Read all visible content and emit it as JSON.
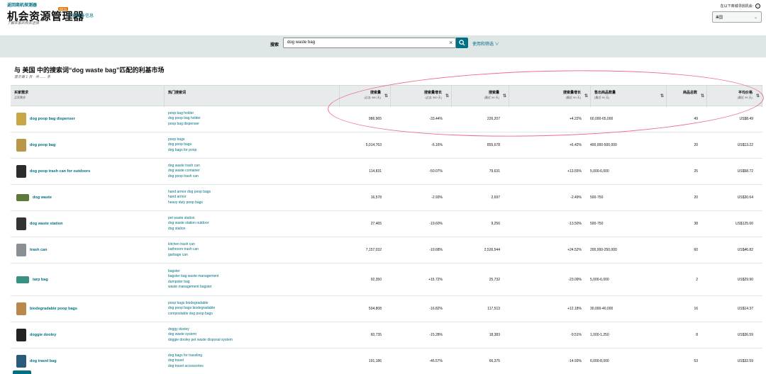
{
  "header": {
    "breadcrumb": "返回商机探测器",
    "title": "机会资源管理器",
    "beta": "BETA",
    "learn_more": "了解更多信息",
    "subtitle": "了解买家的购买选择",
    "marketplace_label": "在以下商城寻找机会:",
    "marketplace_value": "美国"
  },
  "search": {
    "label": "搜索",
    "value": "dog waste bag",
    "filter_link": "使用和筛选 ∨"
  },
  "result": {
    "title": "与 美国 中的搜索词“dog waste bag”匹配的利基市场",
    "subtitle": "显示第 1 页 · 共 ...... 条"
  },
  "table": {
    "headers": [
      {
        "label": "买家需求",
        "sub": "买家需求"
      },
      {
        "label": "热门搜索词",
        "sub": ""
      },
      {
        "label": "搜索量",
        "sub": "(过去 360 天)"
      },
      {
        "label": "搜索量增长",
        "sub": "(过去 360 天)"
      },
      {
        "label": "搜索量",
        "sub": "(最近 90 天)"
      },
      {
        "label": "搜索量增长",
        "sub": "(最近 90 天)"
      },
      {
        "label": "售出商品数量",
        "sub": "(最近 90 天)"
      },
      {
        "label": "商品总数",
        "sub": ""
      },
      {
        "label": "平均价格",
        "sub": "(最近 90 天)"
      }
    ],
    "rows": [
      {
        "niche": "dog poop bag dispenser",
        "thumb_color": "#c8a646",
        "terms": [
          "poop bag holder",
          "dog poop bag holder",
          "poop bag dispenser"
        ],
        "v360": "986,965",
        "g360": "-33.44%",
        "v90": "226,207",
        "g90": "+4.22%",
        "units": "60,000-65,000",
        "products": "49",
        "price": "US$8.49"
      },
      {
        "niche": "dog poop bag",
        "thumb_color": "#b89848",
        "terms": [
          "poop bags",
          "dog poop bags",
          "dog bags for poop"
        ],
        "v360": "5,014,763",
        "g360": "-6.16%",
        "v90": "855,678",
        "g90": "+6.42%",
        "units": "400,000-500,000",
        "products": "20",
        "price": "US$13.22"
      },
      {
        "niche": "dog poop trash can for outdoors",
        "thumb_color": "#2c2c2c",
        "terms": [
          "dog waste trash can",
          "dog waste container",
          "dog poop trash can"
        ],
        "v360": "114,831",
        "g360": "-50.07%",
        "v90": "79,631",
        "g90": "+13.55%",
        "units": "5,000-6,000",
        "products": "25",
        "price": "US$58.72"
      },
      {
        "niche": "dog waste",
        "thumb_color": "#5e7a3a",
        "terms": [
          "hand armor dog poop bags",
          "hand armor",
          "heavy duty poop bags"
        ],
        "v360": "16,578",
        "g360": "-2.93%",
        "v90": "2,697",
        "g90": "-2.49%",
        "units": "500-750",
        "products": "20",
        "price": "US$30.64"
      },
      {
        "niche": "dog waste station",
        "thumb_color": "#333333",
        "terms": [
          "pet waste station",
          "dog waste station outdoor",
          "dog station"
        ],
        "v360": "27,465",
        "g360": "-19.60%",
        "v90": "9,256",
        "g90": "-13.50%",
        "units": "500-750",
        "products": "38",
        "price": "US$125.60"
      },
      {
        "niche": "trash can",
        "thumb_color": "#8a8f93",
        "terms": [
          "kitchen trash can",
          "bathroom trash can",
          "garbage can"
        ],
        "v360": "7,157,032",
        "g360": "-19.68%",
        "v90": "2,526,544",
        "g90": "+24.52%",
        "units": "200,000-250,000",
        "products": "60",
        "price": "US$46.82"
      },
      {
        "niche": "tarp bag",
        "thumb_color": "#3a9080",
        "terms": [
          "bagster",
          "bagster bag waste management",
          "dumpster bag",
          "waste management bagster"
        ],
        "v360": "92,350",
        "g360": "+15.72%",
        "v90": "25,732",
        "g90": "-23.09%",
        "units": "5,000-6,000",
        "products": "2",
        "price": "US$29.90"
      },
      {
        "niche": "biodegradable poop bags",
        "thumb_color": "#b8894a",
        "terms": [
          "poop bags biodegradable",
          "dog poop bags biodegradable",
          "compostable dog poop bags"
        ],
        "v360": "504,808",
        "g360": "-16.82%",
        "v90": "117,513",
        "g90": "+12.18%",
        "units": "30,000-40,000",
        "products": "16",
        "price": "US$14.37"
      },
      {
        "niche": "doggie dooley",
        "thumb_color": "#222222",
        "terms": [
          "doggy dooley",
          "dog waste system",
          "doggie dooley pet waste disposal system"
        ],
        "v360": "60,735",
        "g360": "-15.28%",
        "v90": "18,383",
        "g90": "-9.51%",
        "units": "1,000-1,250",
        "products": "8",
        "price": "US$36.59"
      },
      {
        "niche": "dog travel bag",
        "thumb_color": "#2b5a7a",
        "terms": [
          "dog bags for traveling",
          "dog travel",
          "dog travel accessories"
        ],
        "v360": "191,186",
        "g360": "-46.57%",
        "v90": "66,375",
        "g90": "-14.93%",
        "units": "6,000-8,000",
        "products": "53",
        "price": "US$32.59"
      }
    ]
  },
  "colors": {
    "accent": "#007185",
    "band": "#dfe6e6",
    "annotation": "#f06b8f"
  }
}
